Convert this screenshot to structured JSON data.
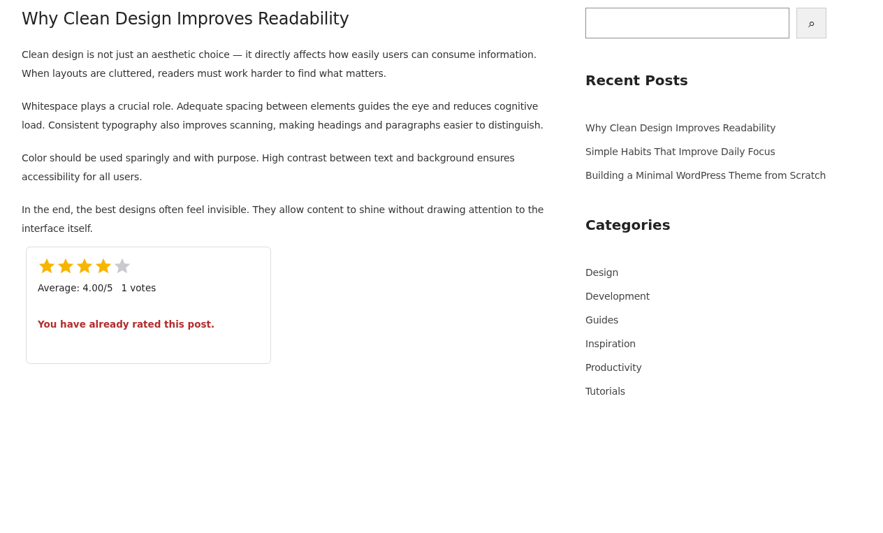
{
  "post": {
    "title": "Why Clean Design Improves Readability",
    "paragraphs": [
      "Clean design is not just an aesthetic choice — it directly affects how easily users can consume information. When layouts are cluttered, readers must work harder to find what matters.",
      "Whitespace plays a crucial role. Adequate spacing between elements guides the eye and reduces cognitive load. Consistent typography also improves scanning, making headings and paragraphs easier to distinguish.",
      "Color should be used sparingly and with purpose. High contrast between text and background ensures accessibility for all users.",
      "In the end, the best designs often feel invisible. They allow content to shine without drawing attention to the interface itself."
    ]
  },
  "rating": {
    "stars": 4,
    "average": "Average: 4.00/5",
    "votes": "1 votes",
    "message": "You have already rated this post."
  },
  "sidebar": {
    "search": {
      "button": "⌕"
    },
    "recent_posts": {
      "heading": "Recent Posts",
      "items": [
        "Why Clean Design Improves Readability",
        "Simple Habits That Improve Daily Focus",
        "Building a Minimal WordPress Theme from Scratch"
      ]
    },
    "categories": {
      "heading": "Categories",
      "items": [
        "Design",
        "Development",
        "Guides",
        "Inspiration",
        "Productivity",
        "Tutorials"
      ]
    }
  }
}
